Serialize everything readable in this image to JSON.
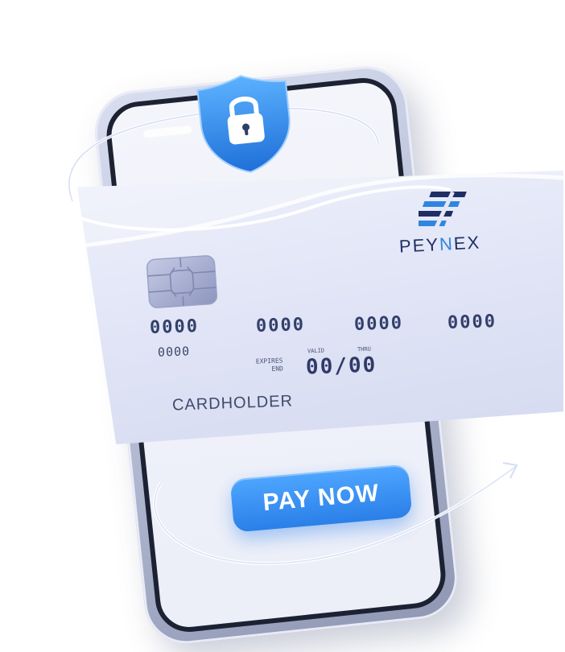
{
  "card": {
    "brand_prefix": "PEY",
    "brand_accent": "N",
    "brand_suffix": "EX",
    "number_groups": [
      "0000",
      "0000",
      "0000",
      "0000"
    ],
    "small_number": "0000",
    "valid_label_1": "VALID",
    "valid_label_2": "THRU",
    "expires_label_line1": "EXPIRES",
    "expires_label_line2": "END",
    "expiry": "00/00",
    "holder": "CARDHOLDER"
  },
  "phone": {
    "pay_button_label": "PAY NOW"
  },
  "colors": {
    "accent_blue": "#2b7fe8",
    "brand_navy": "#1f2f63",
    "card_bg": "#e4e7f6"
  },
  "icons": [
    "lock-icon",
    "shield-icon",
    "chip-icon",
    "brand-logo-icon"
  ]
}
